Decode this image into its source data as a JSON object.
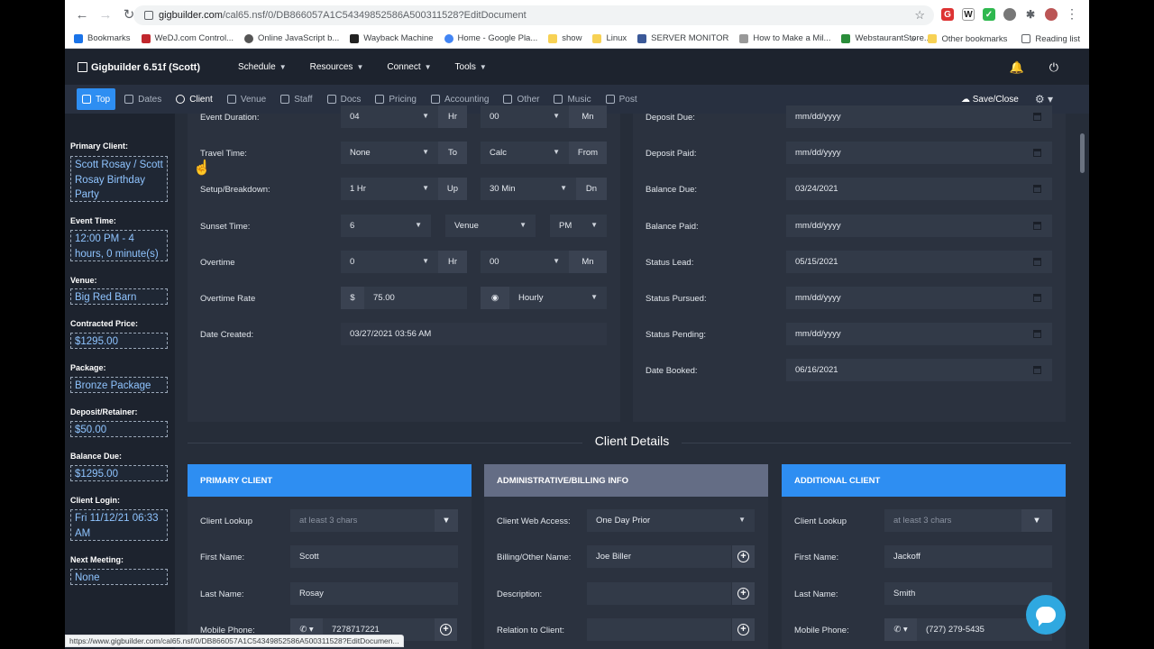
{
  "browser": {
    "url_host": "gigbuilder.com",
    "url_path": "/cal65.nsf/0/DB866057A1C54349852586A500311528?EditDocument",
    "bookmarks": [
      "Bookmarks",
      "WeDJ.com Control...",
      "Online JavaScript b...",
      "Wayback Machine",
      "Home - Google Pla...",
      "show",
      "Linux",
      "SERVER MONITOR",
      "How to Make a Mil...",
      "WebstaurantStore..."
    ],
    "bookmarks_overflow": "»",
    "other_bookmarks": "Other bookmarks",
    "reading_list": "Reading list",
    "status_url": "https://www.gigbuilder.com/cal65.nsf/0/DB866057A1C54349852586A500311528?EditDocumen..."
  },
  "app": {
    "brand": "Gigbuilder 6.51f (Scott)",
    "menu": [
      "Schedule",
      "Resources",
      "Connect",
      "Tools"
    ],
    "tabs": [
      "Top",
      "Dates",
      "Client",
      "Venue",
      "Staff",
      "Docs",
      "Pricing",
      "Accounting",
      "Other",
      "Music",
      "Post"
    ],
    "save_close": "Save/Close"
  },
  "summary": {
    "primary_client_label": "Primary Client:",
    "primary_client": "Scott Rosay / Scott Rosay Birthday Party",
    "event_time_label": "Event Time:",
    "event_time": "12:00 PM - 4 hours, 0 minute(s)",
    "venue_label": "Venue:",
    "venue": "Big Red Barn",
    "contracted_label": "Contracted Price:",
    "contracted": "$1295.00",
    "package_label": "Package:",
    "package": "Bronze Package",
    "deposit_label": "Deposit/Retainer:",
    "deposit": "$50.00",
    "balance_label": "Balance Due:",
    "balance": "$1295.00",
    "login_label": "Client Login:",
    "login": "Fri 11/12/21 06:33 AM",
    "meeting_label": "Next Meeting:",
    "meeting": "None"
  },
  "timing": {
    "event_duration": {
      "label": "Event Duration:",
      "hours": "04",
      "hr": "Hr",
      "minutes": "00",
      "mn": "Mn"
    },
    "travel_time": {
      "label": "Travel Time:",
      "to_val": "None",
      "to": "To",
      "from_val": "Calc",
      "from": "From"
    },
    "setup": {
      "label": "Setup/Breakdown:",
      "up_val": "1 Hr",
      "up": "Up",
      "dn_val": "30 Min",
      "dn": "Dn"
    },
    "sunset": {
      "label": "Sunset Time:",
      "hour": "6",
      "place": "Venue",
      "ampm": "PM"
    },
    "overtime": {
      "label": "Overtime",
      "hours": "0",
      "hr": "Hr",
      "minutes": "00",
      "mn": "Mn"
    },
    "overtime_rate": {
      "label": "Overtime Rate",
      "currency": "$",
      "amount": "75.00",
      "period": "Hourly"
    },
    "date_created": {
      "label": "Date Created:",
      "value": "03/27/2021 03:56 AM"
    }
  },
  "dates": [
    {
      "label": "Deposit Due:",
      "value": "mm/dd/yyyy"
    },
    {
      "label": "Deposit Paid:",
      "value": "mm/dd/yyyy"
    },
    {
      "label": "Balance Due:",
      "value": "03/24/2021"
    },
    {
      "label": "Balance Paid:",
      "value": "mm/dd/yyyy"
    },
    {
      "label": "Status Lead:",
      "value": "05/15/2021"
    },
    {
      "label": "Status Pursued:",
      "value": "mm/dd/yyyy"
    },
    {
      "label": "Status Pending:",
      "value": "mm/dd/yyyy"
    },
    {
      "label": "Date Booked:",
      "value": "06/16/2021"
    }
  ],
  "client_details": {
    "title": "Client Details",
    "primary": {
      "header": "PRIMARY CLIENT",
      "lookup_label": "Client Lookup",
      "lookup_placeholder": "at least 3 chars",
      "first_label": "First Name:",
      "first": "Scott",
      "last_label": "Last Name:",
      "last": "Rosay",
      "phone_label": "Mobile Phone:",
      "phone": "7278717221"
    },
    "admin": {
      "header": "ADMINISTRATIVE/BILLING INFO",
      "access_label": "Client Web Access:",
      "access": "One Day Prior",
      "billing_label": "Billing/Other Name:",
      "billing": "Joe Biller",
      "desc_label": "Description:",
      "desc": "",
      "relation_label": "Relation to Client:",
      "relation": ""
    },
    "additional": {
      "header": "ADDITIONAL CLIENT",
      "lookup_label": "Client Lookup",
      "lookup_placeholder": "at least 3 chars",
      "first_label": "First Name:",
      "first": "Jackoff",
      "last_label": "Last Name:",
      "last": "Smith",
      "phone_label": "Mobile Phone:",
      "phone": "(727) 279-5435"
    }
  }
}
